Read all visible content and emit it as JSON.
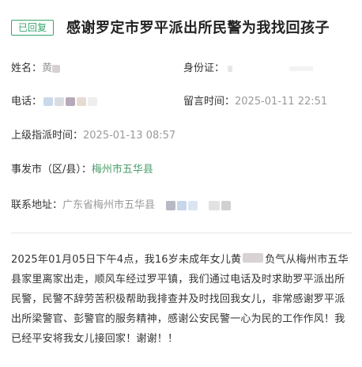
{
  "header": {
    "badge": "已回复",
    "title": "感谢罗定市罗平派出所民警为我找回孩子"
  },
  "info": {
    "name_label": "姓名：",
    "name_value": "黄",
    "id_label": "身份证：",
    "phone_label": "电话：",
    "message_time_label": "留言时间：",
    "message_time_value": "2025-01-11 22:51",
    "assign_time_label": "上级指派时间：",
    "assign_time_value": "2025-01-13 08:57",
    "city_label": "事发市（区/县）：",
    "city_value": "梅州市五华县",
    "address_label": "联系地址：",
    "address_value": "广东省梅州市五华县"
  },
  "content": {
    "part1": "2025年01月05日下午4点，我16岁未成年女儿黄",
    "part2": "负气从梅州市五华县家里离家出走，顺风车经过罗平镇，我们通过电话及时求助罗平派出所民警，民警不辞劳苦积极帮助我排查并及时找回我女儿，非常感谢罗平派出所梁警官、彭警官的服务精神，感谢公安民警一心为民的工作作风！我已经平安将我女儿接回家！谢谢！！"
  },
  "colors": {
    "accent_green": "#37a66c",
    "label_text": "#333333",
    "value_text": "#9a9a9a"
  }
}
